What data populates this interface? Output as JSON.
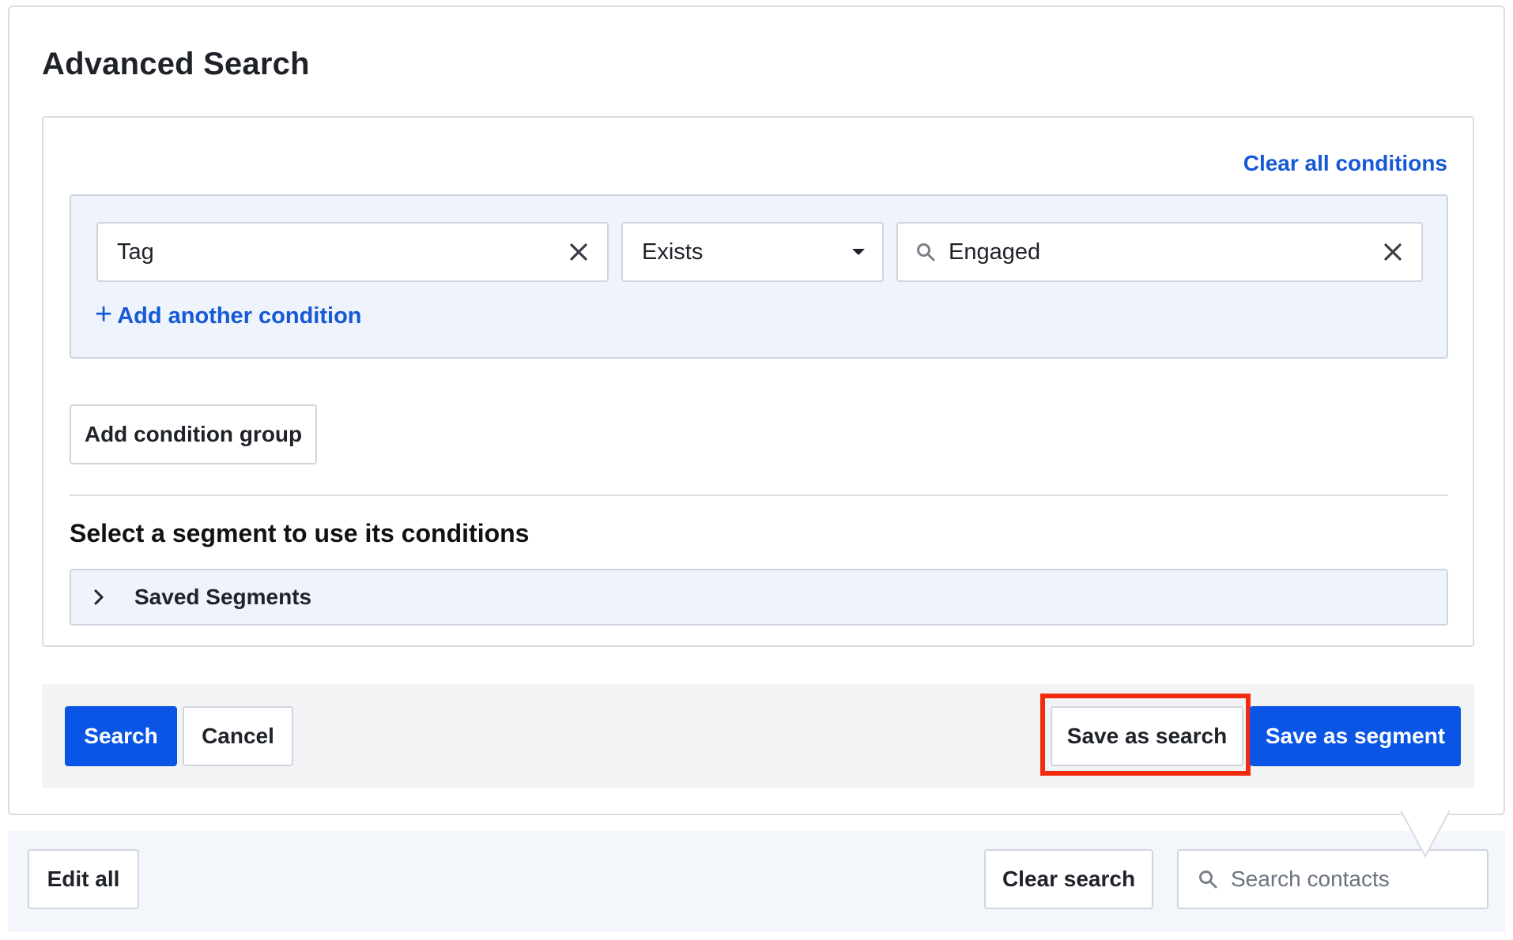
{
  "panel": {
    "title": "Advanced Search"
  },
  "builder": {
    "clear_all_label": "Clear all conditions",
    "condition": {
      "field_value": "Tag",
      "operator_value": "Exists",
      "tag_value": "Engaged"
    },
    "add_condition_label": "Add another condition",
    "add_group_label": "Add condition group",
    "segments_heading": "Select a segment to use its conditions",
    "saved_segments_label": "Saved Segments"
  },
  "actions": {
    "search_label": "Search",
    "cancel_label": "Cancel",
    "save_search_label": "Save as search",
    "save_segment_label": "Save as segment"
  },
  "bottom_bar": {
    "edit_all_label": "Edit all",
    "clear_search_label": "Clear search",
    "search_placeholder": "Search contacts"
  },
  "icons": {
    "clear_field": "close-icon",
    "dropdown": "caret-down-icon",
    "search": "search-icon",
    "add": "plus-icon",
    "expand": "chevron-right-icon"
  },
  "colors": {
    "primary": "#0b55e6",
    "link": "#1559d6",
    "highlight": "#f22a0f",
    "group_background": "#eef3fc"
  }
}
